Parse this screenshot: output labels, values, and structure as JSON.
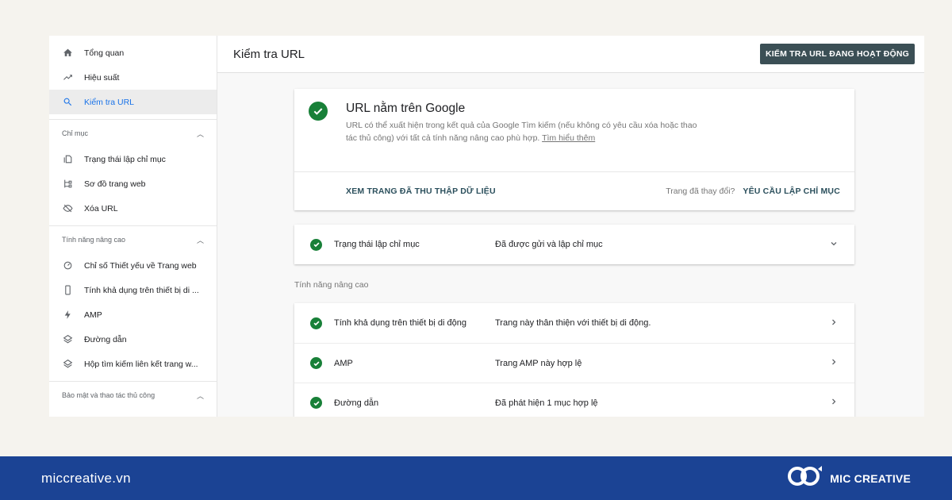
{
  "sidebar": {
    "top_items": [
      {
        "label": "Tổng quan",
        "icon": "home-icon"
      },
      {
        "label": "Hiệu suất",
        "icon": "trending-up-icon"
      },
      {
        "label": "Kiểm tra URL",
        "icon": "search-icon",
        "active": true
      }
    ],
    "sections": [
      {
        "title": "Chỉ mục",
        "items": [
          {
            "label": "Trạng thái lập chỉ mục",
            "icon": "pages-icon"
          },
          {
            "label": "Sơ đồ trang web",
            "icon": "sitemap-icon"
          },
          {
            "label": "Xóa URL",
            "icon": "visibility-off-icon"
          }
        ]
      },
      {
        "title": "Tính năng nâng cao",
        "items": [
          {
            "label": "Chỉ số Thiết yếu về Trang web",
            "icon": "speed-icon"
          },
          {
            "label": "Tính khả dụng trên thiết bị di ...",
            "icon": "phone-icon"
          },
          {
            "label": "AMP",
            "icon": "bolt-icon"
          },
          {
            "label": "Đường dẫn",
            "icon": "layers-icon"
          },
          {
            "label": "Hộp tìm kiếm liên kết trang w...",
            "icon": "layers-icon"
          }
        ]
      },
      {
        "title": "Bảo mật và thao tác thủ công",
        "items": []
      }
    ]
  },
  "header": {
    "title": "Kiểm tra URL",
    "live_test_button": "KIỂM TRA URL ĐANG HOẠT ĐỘNG"
  },
  "result": {
    "title": "URL nằm trên Google",
    "description": "URL có thể xuất hiện trong kết quả của Google Tìm kiếm (nếu không có yêu cầu xóa hoặc thao tác thủ công) với tất cả tính năng nâng cao phù hợp.",
    "learn_more": "Tìm hiểu thêm",
    "view_crawled": "XEM TRANG ĐÃ THU THẬP DỮ LIỆU",
    "changed_question": "Trang đã thay đổi?",
    "request_indexing": "YÊU CẦU LẬP CHỈ MỤC"
  },
  "index_status": {
    "label": "Trạng thái lập chỉ mục",
    "value": "Đã được gửi và lập chỉ mục"
  },
  "enhancements": {
    "heading": "Tính năng nâng cao",
    "rows": [
      {
        "label": "Tính khả dụng trên thiết bị di động",
        "value": "Trang này thân thiện với thiết bị di động."
      },
      {
        "label": "AMP",
        "value": "Trang AMP này hợp lệ"
      },
      {
        "label": "Đường dẫn",
        "value": "Đã phát hiện 1 mục hợp lệ"
      }
    ]
  },
  "footer": {
    "site": "miccreative.vn",
    "brand": "MIC CREATIVE"
  },
  "colors": {
    "background": "#f5f3ee",
    "footer": "#1b4394",
    "success": "#188038",
    "live_button": "#3b4f55",
    "action_text": "#2b4f5c"
  }
}
